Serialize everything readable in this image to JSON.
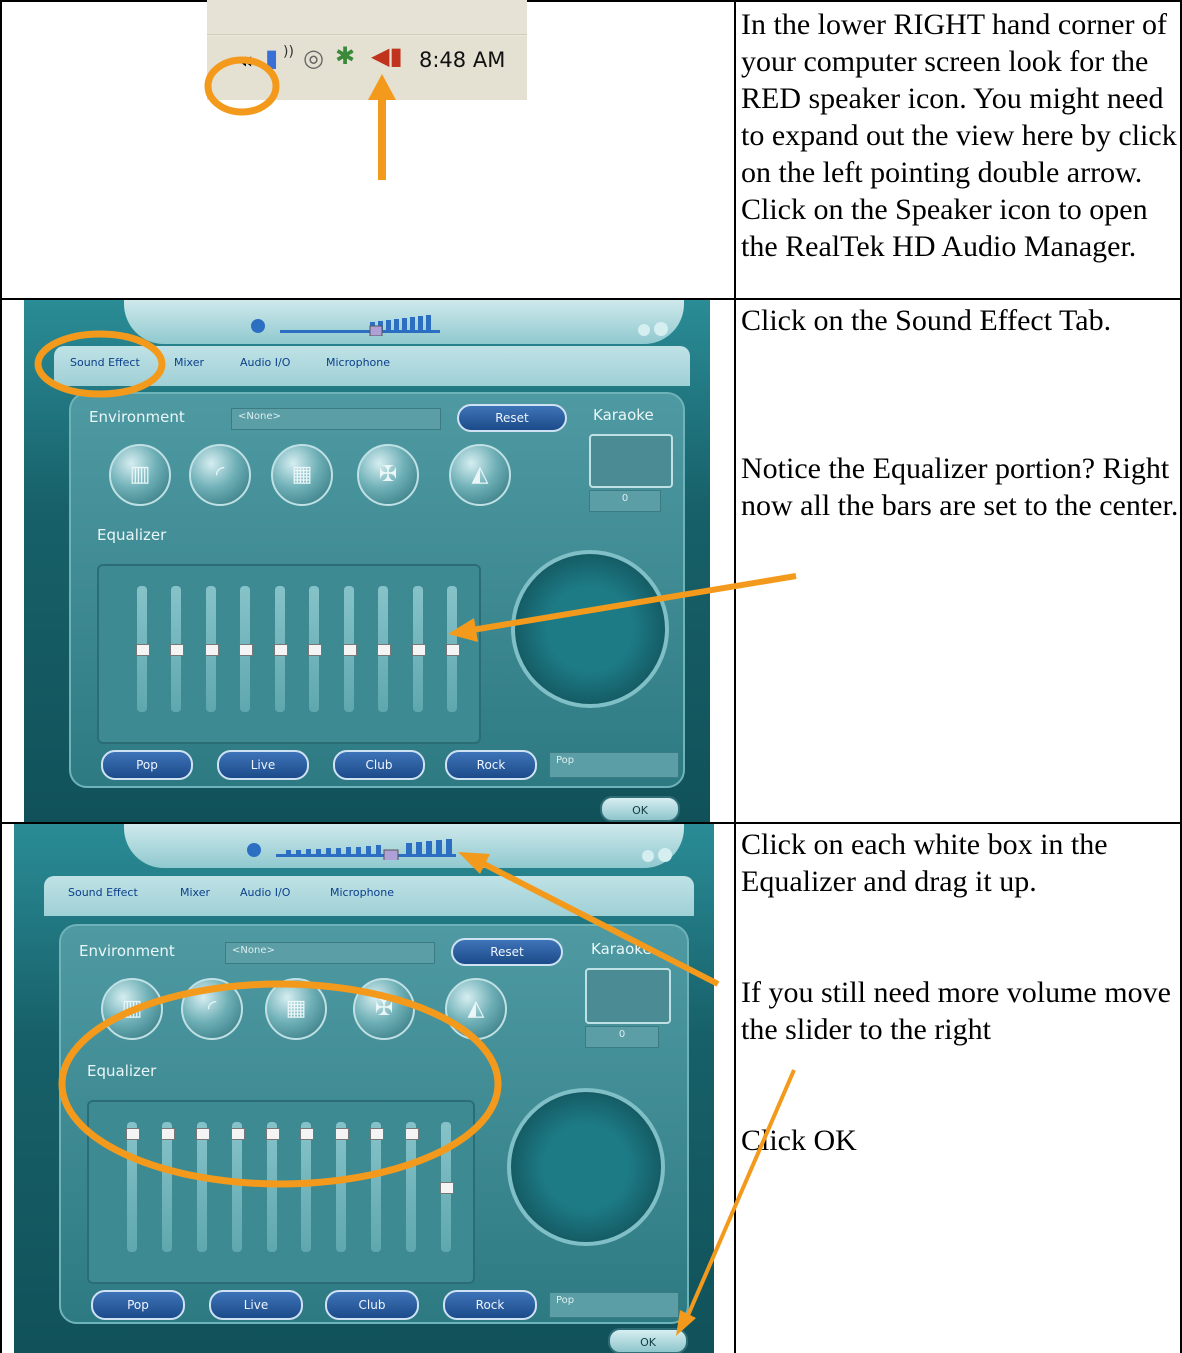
{
  "rows": [
    {
      "text": "In the lower RIGHT hand corner of your computer screen look for the RED speaker icon. You might need to expand out the view here by click on the left pointing double arrow.  Click on the Speaker icon to open the RealTek HD Audio Manager."
    },
    {
      "text_lines": [
        "Click on the Sound Effect Tab.",
        "Notice the Equalizer portion? Right now all the bars are set to the center."
      ]
    },
    {
      "text_lines": [
        "Click on each white box in the Equalizer and drag it up.",
        "If you still need more volume move the slider to the right",
        "Click OK"
      ]
    }
  ],
  "tray": {
    "time": "8:48 AM",
    "icons": [
      "chevron-double-left-icon",
      "network-icon",
      "disc-icon",
      "connection-icon",
      "speaker-icon"
    ]
  },
  "audio_manager": {
    "tabs": [
      "Sound Effect",
      "Mixer",
      "Audio I/O",
      "Microphone"
    ],
    "environment_label": "Environment",
    "environment_value": "<None>",
    "reset_label": "Reset",
    "karaoke_label": "Karaoke",
    "karaoke_value": "0",
    "equalizer_label": "Equalizer",
    "presets": [
      "Pop",
      "Live",
      "Club",
      "Rock"
    ],
    "preset_select_value": "Pop",
    "ok_label": "OK",
    "eq_bands": 10,
    "eq_level_first": 0.5,
    "eq_level_second": 0.95
  },
  "colors": {
    "annotation": "#f39a1c"
  }
}
